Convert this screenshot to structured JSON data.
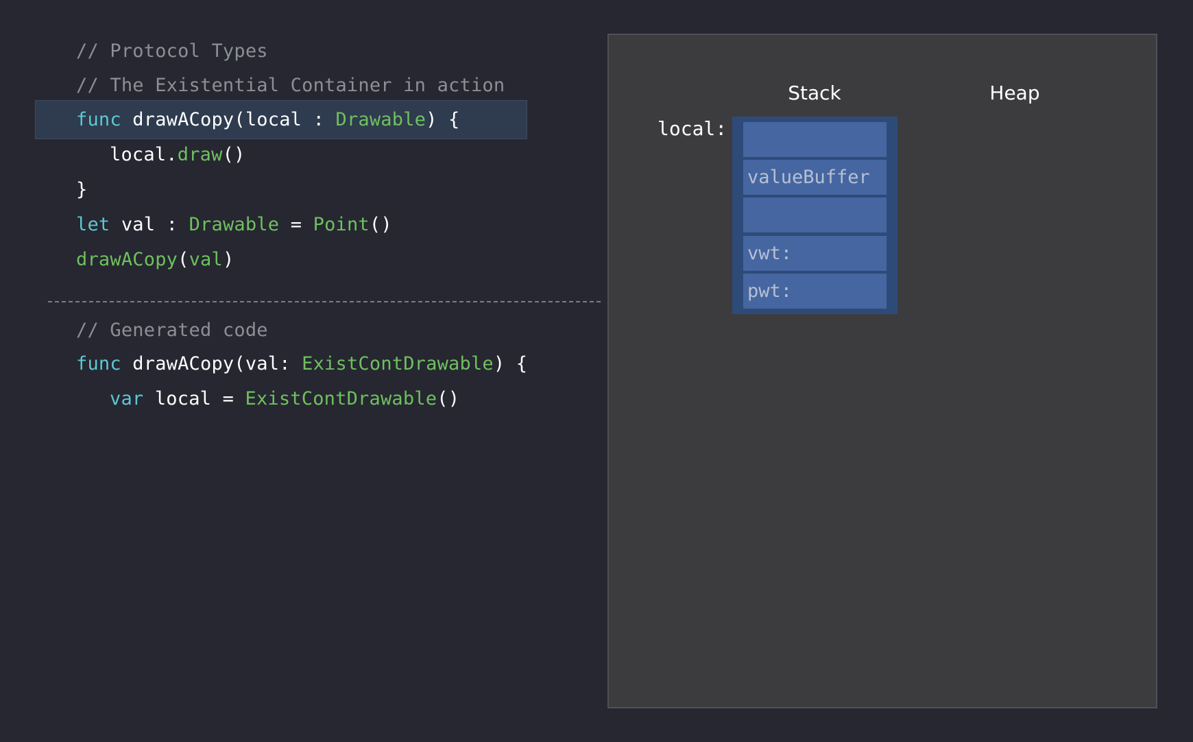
{
  "code": {
    "comment_1": "// Protocol Types",
    "comment_2": "// The Existential Container in action",
    "line_func_1": {
      "kw": "func",
      "name": " drawACopy(local : ",
      "type": "Drawable",
      "tail": ") {"
    },
    "line_call": {
      "obj": "local.",
      "method": "draw",
      "tail": "()"
    },
    "line_close": "}",
    "line_let": {
      "kw": "let",
      "name": " val : ",
      "type": "Drawable",
      "eq": " = ",
      "ctor": "Point",
      "tail": "()"
    },
    "line_invoke": {
      "fn": "drawACopy",
      "open": "(",
      "arg": "val",
      "close": ")"
    },
    "comment_3": "// Generated code",
    "line_func_2": {
      "kw": "func",
      "name": " drawACopy(val: ",
      "type": "ExistContDrawable",
      "tail": ") {"
    },
    "line_var": {
      "kw": "var",
      "name": " local = ",
      "type": "ExistContDrawable",
      "tail": "()"
    }
  },
  "diagram": {
    "stack_heading": "Stack",
    "heap_heading": "Heap",
    "variable_label": "local:",
    "cells": [
      "",
      "valueBuffer",
      "",
      "vwt:",
      "pwt:"
    ]
  },
  "colors": {
    "background": "#262731",
    "comment": "#8d8f96",
    "keyword": "#5cc8d3",
    "type": "#6fc05f",
    "highlight": "#2f3b4e",
    "panel": "#3c3c3f",
    "container": "#2e4a78",
    "cell": "#4666a1"
  }
}
